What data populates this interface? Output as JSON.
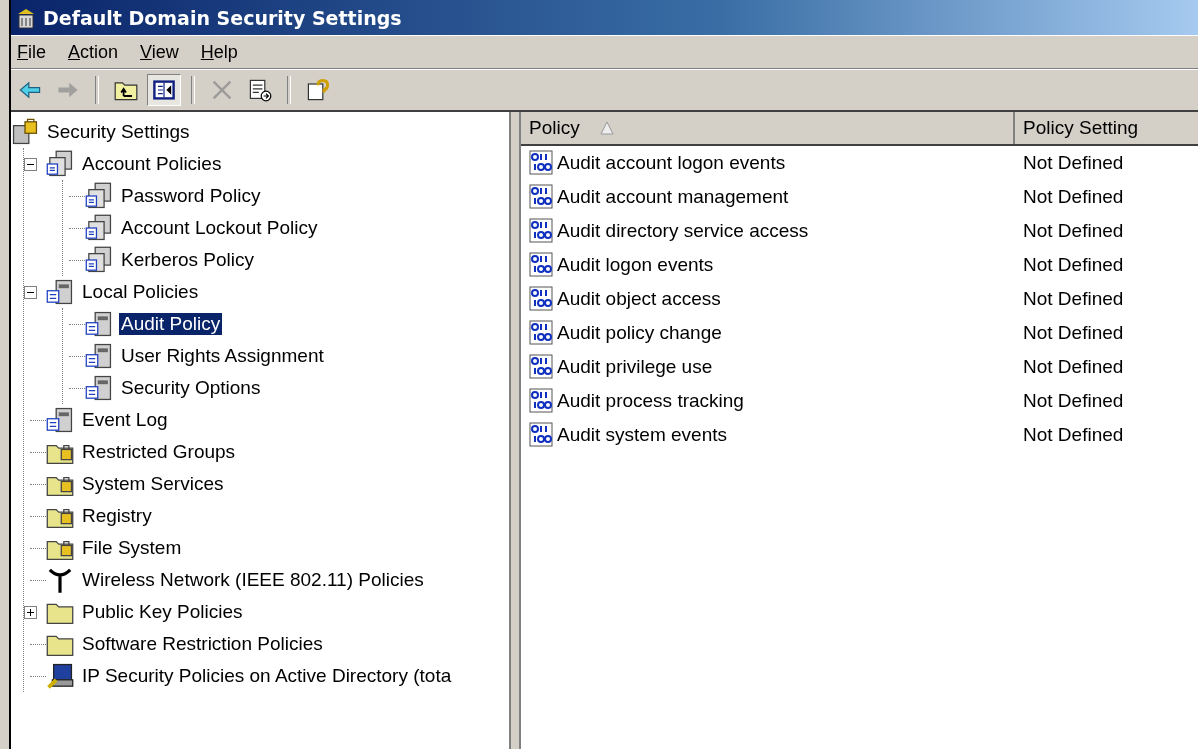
{
  "window": {
    "title": "Default Domain Security Settings"
  },
  "menu": [
    "File",
    "Action",
    "View",
    "Help"
  ],
  "toolbar": [
    {
      "kind": "back",
      "disabled": false,
      "pressed": false
    },
    {
      "kind": "forward",
      "disabled": true,
      "pressed": false
    },
    {
      "kind": "separator"
    },
    {
      "kind": "up",
      "disabled": false,
      "pressed": false
    },
    {
      "kind": "tree-toggle",
      "disabled": false,
      "pressed": true
    },
    {
      "kind": "separator"
    },
    {
      "kind": "delete",
      "disabled": true,
      "pressed": false
    },
    {
      "kind": "export",
      "disabled": false,
      "pressed": false
    },
    {
      "kind": "separator"
    },
    {
      "kind": "help",
      "disabled": false,
      "pressed": false
    }
  ],
  "tree": [
    {
      "label": "Security Settings",
      "kind": "root",
      "selected": false,
      "children": [
        {
          "label": "Account Policies",
          "kind": "policy",
          "selected": false,
          "expanded": true,
          "children": [
            {
              "label": "Password Policy",
              "kind": "policy",
              "selected": false
            },
            {
              "label": "Account Lockout Policy",
              "kind": "policy",
              "selected": false
            },
            {
              "label": "Kerberos Policy",
              "kind": "policy",
              "selected": false
            }
          ]
        },
        {
          "label": "Local Policies",
          "kind": "server",
          "selected": false,
          "expanded": true,
          "children": [
            {
              "label": "Audit Policy",
              "kind": "server",
              "selected": true
            },
            {
              "label": "User Rights Assignment",
              "kind": "server",
              "selected": false
            },
            {
              "label": "Security Options",
              "kind": "server",
              "selected": false
            }
          ]
        },
        {
          "label": "Event Log",
          "kind": "server",
          "selected": false
        },
        {
          "label": "Restricted Groups",
          "kind": "locked-folder",
          "selected": false
        },
        {
          "label": "System Services",
          "kind": "locked-folder",
          "selected": false
        },
        {
          "label": "Registry",
          "kind": "locked-folder",
          "selected": false
        },
        {
          "label": "File System",
          "kind": "locked-folder",
          "selected": false
        },
        {
          "label": "Wireless Network (IEEE 802.11) Policies",
          "kind": "antenna",
          "selected": false
        },
        {
          "label": "Public Key Policies",
          "kind": "folder",
          "selected": false,
          "expanded": false
        },
        {
          "label": "Software Restriction Policies",
          "kind": "folder",
          "selected": false
        },
        {
          "label": "IP Security Policies on Active Directory (tota",
          "kind": "monitor",
          "selected": false
        }
      ]
    }
  ],
  "table": {
    "columns": [
      {
        "label": "Policy",
        "sorted": true
      },
      {
        "label": "Policy Setting",
        "sorted": false
      }
    ],
    "rows": [
      {
        "policy": "Audit account logon events",
        "setting": "Not Defined"
      },
      {
        "policy": "Audit account management",
        "setting": "Not Defined"
      },
      {
        "policy": "Audit directory service access",
        "setting": "Not Defined"
      },
      {
        "policy": "Audit logon events",
        "setting": "Not Defined"
      },
      {
        "policy": "Audit object access",
        "setting": "Not Defined"
      },
      {
        "policy": "Audit policy change",
        "setting": "Not Defined"
      },
      {
        "policy": "Audit privilege use",
        "setting": "Not Defined"
      },
      {
        "policy": "Audit process tracking",
        "setting": "Not Defined"
      },
      {
        "policy": "Audit system events",
        "setting": "Not Defined"
      }
    ]
  }
}
